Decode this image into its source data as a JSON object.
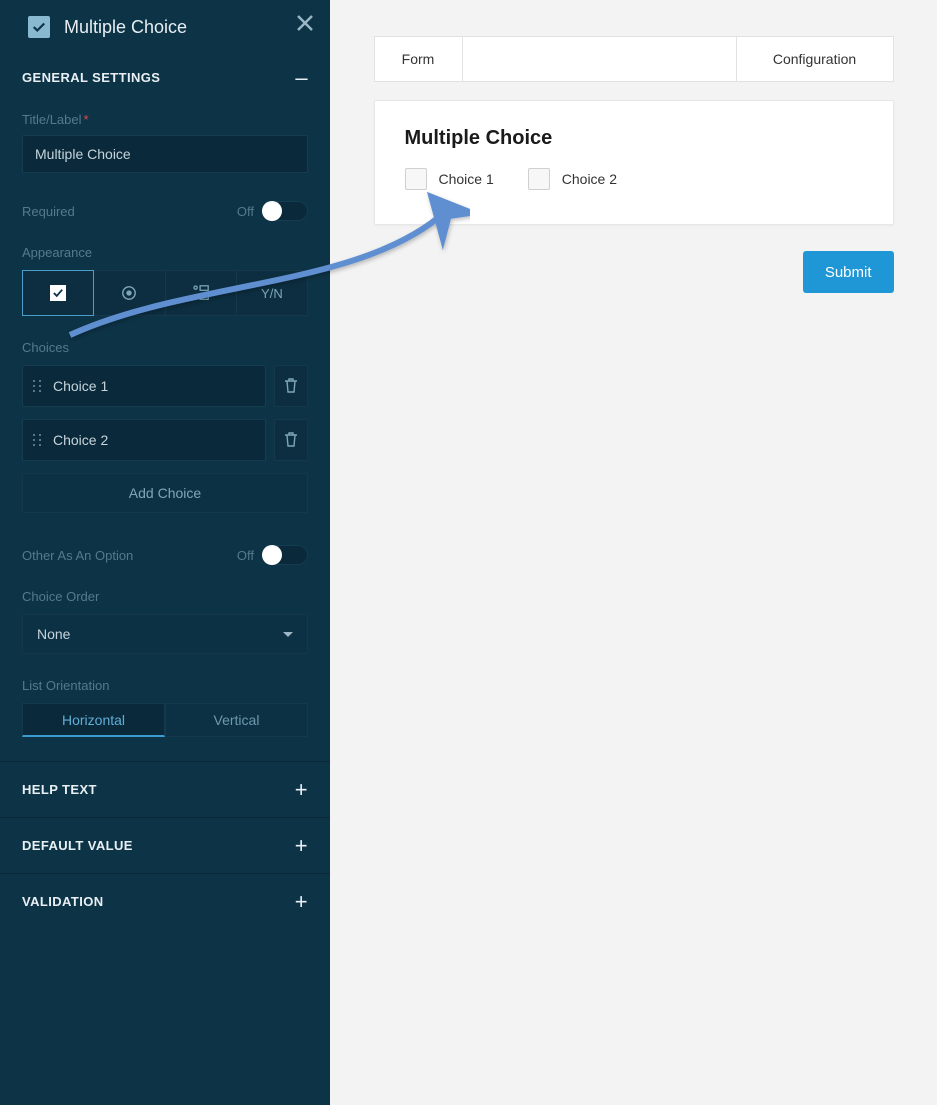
{
  "sidebar": {
    "title": "Multiple Choice",
    "sections": {
      "general": {
        "label": "GENERAL SETTINGS",
        "expanded_icon": "–"
      },
      "help_text": {
        "label": "HELP TEXT"
      },
      "default_value": {
        "label": "DEFAULT VALUE"
      },
      "validation": {
        "label": "VALIDATION"
      }
    },
    "title_label": {
      "label": "Title/Label",
      "value": "Multiple Choice"
    },
    "required": {
      "label": "Required",
      "state_text": "Off"
    },
    "appearance": {
      "label": "Appearance",
      "yn_label": "Y/N"
    },
    "choices": {
      "label": "Choices",
      "items": [
        "Choice 1",
        "Choice 2"
      ],
      "add_label": "Add Choice"
    },
    "other_option": {
      "label": "Other As An Option",
      "state_text": "Off"
    },
    "choice_order": {
      "label": "Choice Order",
      "value": "None"
    },
    "list_orientation": {
      "label": "List Orientation",
      "options": [
        "Horizontal",
        "Vertical"
      ]
    }
  },
  "main": {
    "tabs": {
      "form": "Form",
      "configuration": "Configuration"
    },
    "form_title": "Multiple Choice",
    "options": [
      "Choice 1",
      "Choice 2"
    ],
    "submit": "Submit"
  }
}
